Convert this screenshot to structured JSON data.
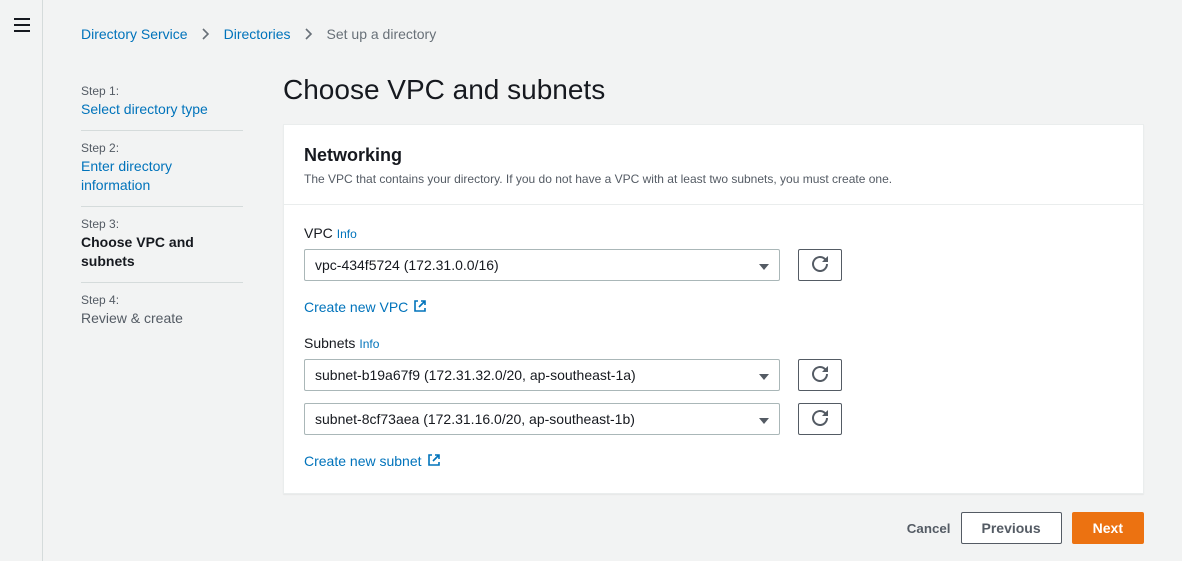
{
  "breadcrumb": {
    "service": "Directory Service",
    "directories": "Directories",
    "current": "Set up a directory"
  },
  "steps": [
    {
      "label": "Step 1:",
      "name": "Select directory type",
      "state": "link"
    },
    {
      "label": "Step 2:",
      "name": "Enter directory information",
      "state": "link"
    },
    {
      "label": "Step 3:",
      "name": "Choose VPC and subnets",
      "state": "current"
    },
    {
      "label": "Step 4:",
      "name": "Review & create",
      "state": "future"
    }
  ],
  "page": {
    "title": "Choose VPC and subnets"
  },
  "panel": {
    "heading": "Networking",
    "description": "The VPC that contains your directory. If you do not have a VPC with at least two subnets, you must create one."
  },
  "vpc": {
    "label": "VPC",
    "info": "Info",
    "selected": "vpc-434f5724 (172.31.0.0/16)",
    "createLink": "Create new VPC"
  },
  "subnets": {
    "label": "Subnets",
    "info": "Info",
    "selected1": "subnet-b19a67f9 (172.31.32.0/20, ap-southeast-1a)",
    "selected2": "subnet-8cf73aea (172.31.16.0/20, ap-southeast-1b)",
    "createLink": "Create new subnet"
  },
  "footer": {
    "cancel": "Cancel",
    "previous": "Previous",
    "next": "Next"
  }
}
